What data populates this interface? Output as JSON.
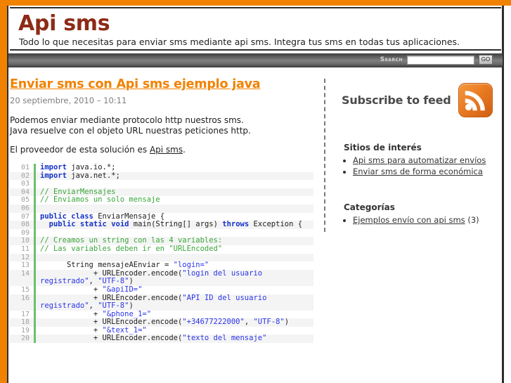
{
  "site": {
    "title": "Api sms",
    "tagline": "Todo lo que necesitas para enviar sms mediante api sms. Integra tus sms en todas tus aplicaciones.",
    "title_color": "#8c2b17",
    "accent_color": "#f18200"
  },
  "search": {
    "label": "Search",
    "value": "",
    "placeholder": "",
    "button_label": "GO"
  },
  "post": {
    "title": "Enviar sms con Api sms ejemplo java",
    "date": "20 septiembre, 2010 – 10:11",
    "paragraph1_line1": "Podemos enviar mediante protocolo http nuestros sms.",
    "paragraph1_line2": "Java resuelve con el objeto URL nuestras peticiones http.",
    "paragraph2_prefix": "El proveedor de esta solución es ",
    "paragraph2_link": "Api sms",
    "paragraph2_suffix": "."
  },
  "code": {
    "language": "java",
    "lines": [
      {
        "num": "01",
        "segments": [
          {
            "t": "import",
            "c": "kw"
          },
          {
            "t": " java.io.*;",
            "c": ""
          }
        ]
      },
      {
        "num": "02",
        "segments": [
          {
            "t": "import",
            "c": "kw"
          },
          {
            "t": " java.net.*;",
            "c": ""
          }
        ]
      },
      {
        "num": "03",
        "segments": [
          {
            "t": " ",
            "c": ""
          }
        ]
      },
      {
        "num": "04",
        "segments": [
          {
            "t": "// EnviarMensajes",
            "c": "cm"
          }
        ]
      },
      {
        "num": "05",
        "segments": [
          {
            "t": "// Enviamos un solo mensaje",
            "c": "cm"
          }
        ]
      },
      {
        "num": "06",
        "segments": [
          {
            "t": " ",
            "c": ""
          }
        ]
      },
      {
        "num": "07",
        "segments": [
          {
            "t": "public",
            "c": "kw"
          },
          {
            "t": " ",
            "c": ""
          },
          {
            "t": "class",
            "c": "kw"
          },
          {
            "t": " EnviarMensaje {",
            "c": ""
          }
        ]
      },
      {
        "num": "08",
        "segments": [
          {
            "t": "  ",
            "c": ""
          },
          {
            "t": "public",
            "c": "kw"
          },
          {
            "t": " ",
            "c": ""
          },
          {
            "t": "static",
            "c": "kw"
          },
          {
            "t": " ",
            "c": ""
          },
          {
            "t": "void",
            "c": "kw"
          },
          {
            "t": " main(String[] args) ",
            "c": ""
          },
          {
            "t": "throws",
            "c": "kw"
          },
          {
            "t": " Exception {",
            "c": ""
          }
        ]
      },
      {
        "num": "09",
        "segments": [
          {
            "t": " ",
            "c": ""
          }
        ]
      },
      {
        "num": "10",
        "segments": [
          {
            "t": "// Creamos un string con las 4 variables:",
            "c": "cm"
          }
        ]
      },
      {
        "num": "11",
        "segments": [
          {
            "t": "// Las variables deben ir en \"URLEncoded\"",
            "c": "cm"
          }
        ]
      },
      {
        "num": "12",
        "segments": [
          {
            "t": " ",
            "c": ""
          }
        ]
      },
      {
        "num": "13",
        "segments": [
          {
            "t": "      String mensajeAEnviar = ",
            "c": ""
          },
          {
            "t": "\"login=\"",
            "c": "str"
          }
        ]
      },
      {
        "num": "14",
        "segments": [
          {
            "t": "            + URLEncoder.encode(",
            "c": ""
          },
          {
            "t": "\"login del usuario registrado\"",
            "c": "str"
          },
          {
            "t": ", ",
            "c": ""
          },
          {
            "t": "\"UTF-8\"",
            "c": "str"
          },
          {
            "t": ")",
            "c": ""
          }
        ]
      },
      {
        "num": "15",
        "segments": [
          {
            "t": "            + ",
            "c": ""
          },
          {
            "t": "\"&apiID=\"",
            "c": "str"
          }
        ]
      },
      {
        "num": "16",
        "segments": [
          {
            "t": "            + URLEncoder.encode(",
            "c": ""
          },
          {
            "t": "\"API ID del usuario registrado\"",
            "c": "str"
          },
          {
            "t": ", ",
            "c": ""
          },
          {
            "t": "\"UTF-8\"",
            "c": "str"
          },
          {
            "t": ")",
            "c": ""
          }
        ]
      },
      {
        "num": "17",
        "segments": [
          {
            "t": "            + ",
            "c": ""
          },
          {
            "t": "\"&phone_1=\"",
            "c": "str"
          }
        ]
      },
      {
        "num": "18",
        "segments": [
          {
            "t": "            + URLEncoder.encode(",
            "c": ""
          },
          {
            "t": "\"+34677222000\"",
            "c": "str"
          },
          {
            "t": ", ",
            "c": ""
          },
          {
            "t": "\"UTF-8\"",
            "c": "str"
          },
          {
            "t": ")",
            "c": ""
          }
        ]
      },
      {
        "num": "19",
        "segments": [
          {
            "t": "            + ",
            "c": ""
          },
          {
            "t": "\"&text_1=\"",
            "c": "str"
          }
        ]
      },
      {
        "num": "20",
        "segments": [
          {
            "t": "            + URLEncoder.encode(",
            "c": ""
          },
          {
            "t": "\"texto del mensaje\"",
            "c": "str"
          }
        ]
      }
    ]
  },
  "sidebar": {
    "feed_label": "Subscribe to feed",
    "feed_icon": "rss-icon",
    "sections": [
      {
        "heading": "Sitios de interés",
        "items": [
          {
            "label": "Api sms para automatizar envíos",
            "count": ""
          },
          {
            "label": "Enviar sms de forma económica",
            "count": ""
          }
        ]
      },
      {
        "heading": "Categorías",
        "items": [
          {
            "label": "Ejemplos envío con api sms",
            "count": " (3)"
          }
        ]
      }
    ]
  }
}
